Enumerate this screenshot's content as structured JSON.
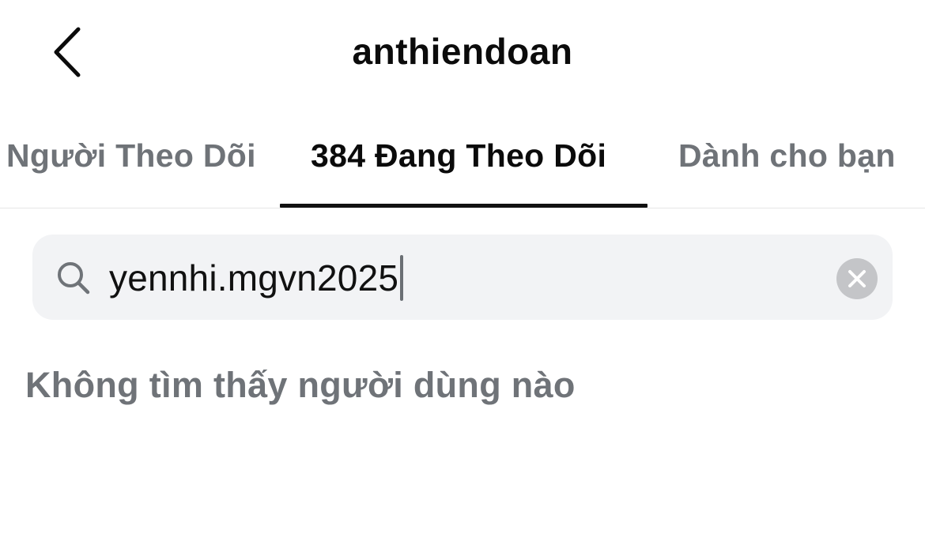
{
  "header": {
    "title": "anthiendoan",
    "back_icon": "chevron-left-icon"
  },
  "tabs": [
    {
      "label": "Người Theo Dõi",
      "active": false
    },
    {
      "label": "384 Đang Theo Dõi",
      "active": true
    },
    {
      "label": "Dành cho bạn",
      "active": false
    }
  ],
  "search": {
    "value": "yennhi.mgvn2025",
    "icon": "search-icon",
    "clear_icon": "clear-icon"
  },
  "results": {
    "empty_message": "Không tìm thấy người dùng nào"
  },
  "colors": {
    "primary_text": "#0b0b0b",
    "secondary_text": "#6f7378",
    "search_bg": "#f2f3f5",
    "indicator": "#111111"
  }
}
